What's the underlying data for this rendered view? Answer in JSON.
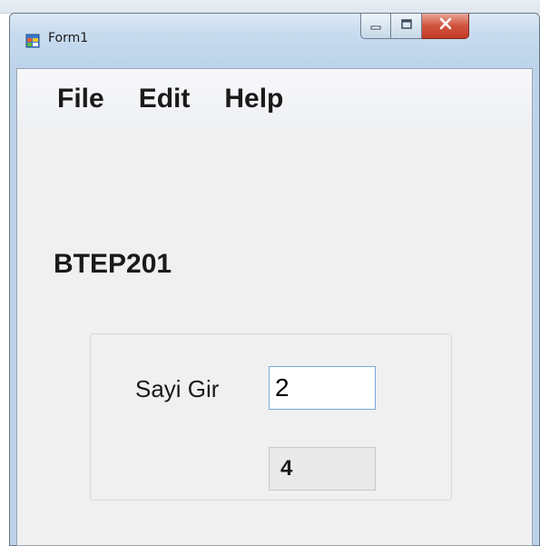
{
  "window": {
    "title": "Form1",
    "icon": "winforms-app-icon"
  },
  "menu": {
    "items": [
      {
        "label": "File"
      },
      {
        "label": "Edit"
      },
      {
        "label": "Help"
      }
    ]
  },
  "main": {
    "label": "BTEP201",
    "input_label": "Sayi Gir",
    "input_value": "2",
    "result_value": "4"
  },
  "colors": {
    "close_button": "#c53a25",
    "input_focus_border": "#7aa7d6",
    "client_background": "#f0f0f0"
  }
}
